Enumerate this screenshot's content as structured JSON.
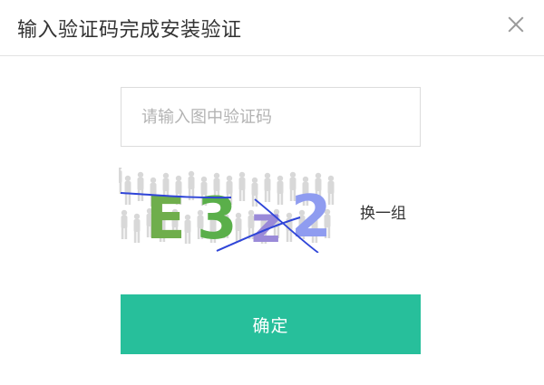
{
  "dialog": {
    "title": "输入验证码完成安装验证",
    "close_icon": "close-icon"
  },
  "form": {
    "code_value": "",
    "code_placeholder": "请输入图中验证码",
    "captcha_text": "E3z2",
    "captcha_colors": [
      "#6fae4c",
      "#5aaf4a",
      "#9a8ad8",
      "#8f9cf0"
    ],
    "refresh_label": "换一组",
    "confirm_label": "确定"
  },
  "colors": {
    "primary": "#27bf9b",
    "captcha_noise_line": "#2f45d8"
  }
}
